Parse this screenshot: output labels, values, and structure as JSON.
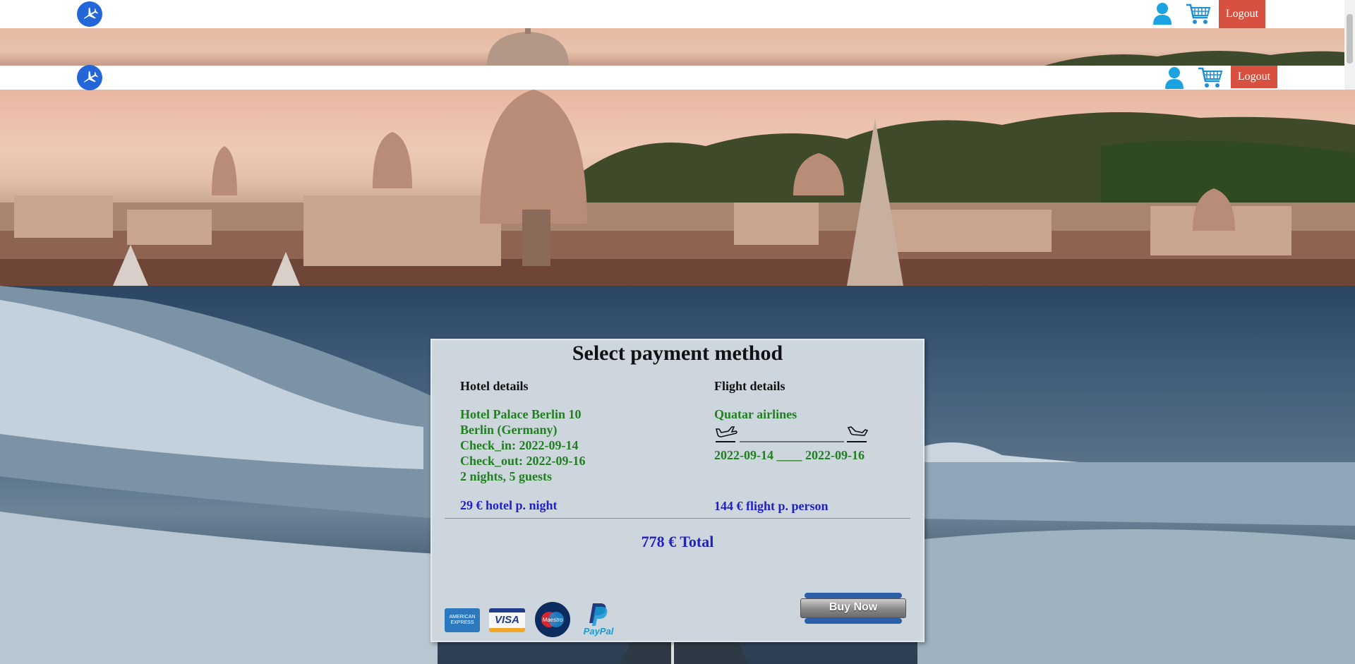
{
  "header": {
    "logout_label": "Logout",
    "icons": [
      "plane-logo-icon",
      "user-icon",
      "cart-icon"
    ]
  },
  "payment": {
    "title": "Select payment method",
    "hotel": {
      "heading": "Hotel details",
      "name": "Hotel Palace Berlin 10",
      "location": "Berlin (Germany)",
      "check_in": "Check_in: 2022-09-14",
      "check_out": "Check_out: 2022-09-16",
      "stay": "2 nights, 5 guests",
      "price": "29 € hotel p. night"
    },
    "flight": {
      "heading": "Flight details",
      "airline": "Quatar airlines",
      "dates": "2022-09-14 ____ 2022-09-16",
      "price": "144 € flight p. person"
    },
    "total": "778 € Total",
    "methods": [
      "American Express",
      "Visa",
      "Maestro",
      "PayPal"
    ],
    "amex_label": "AMERICAN EXPRESS",
    "visa_label": "VISA",
    "maestro_label": "Maestro",
    "paypal_label": "PayPal",
    "buy_label": "Buy Now"
  },
  "colors": {
    "logout_bg": "#d8503f",
    "logo_bg": "#2266d8",
    "icon_blue": "#1aa3e0",
    "hotel_text": "#208020",
    "price_text": "#2020c8",
    "card_bg": "#cdd6dd"
  }
}
